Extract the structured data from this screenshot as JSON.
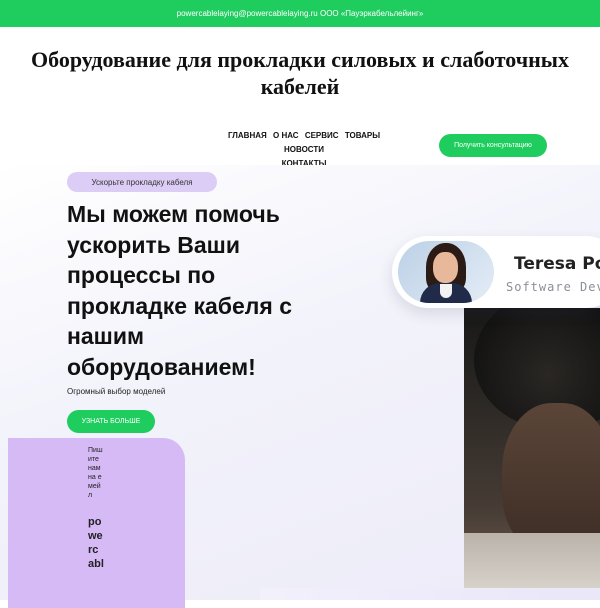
{
  "topbar": {
    "contact_text": "powercablelaying@powercablelaying.ru ООО «Пауэркабельлейинг»"
  },
  "header": {
    "headline": "Оборудование для прокладки силовых и слаботочных кабелей"
  },
  "nav": {
    "items": [
      {
        "label": "ГЛАВНАЯ"
      },
      {
        "label": "О НАС"
      },
      {
        "label": "СЕРВИС"
      },
      {
        "label": "ТОВАРЫ"
      },
      {
        "label": "НОВОСТИ"
      },
      {
        "label": "КОНТАКТЫ"
      }
    ],
    "cta_label": "Получить консультацию"
  },
  "hero": {
    "badge": "Ускорьте прокладку кабеля",
    "title": "Мы можем помочь ускорить Ваши процессы по прокладке кабеля с нашим оборудованием!",
    "subtitle": "Огромный выбор моделей",
    "button_label": "УЗНАТЬ БОЛЬШЕ"
  },
  "email_card": {
    "label": "Пишите нам на емейл",
    "value": "powercabl"
  },
  "profile_card": {
    "name": "Teresa Po",
    "role": "Software Dev"
  },
  "colors": {
    "accent_green": "#1fcd5f",
    "badge_lavender": "#dccdf6",
    "card_purple": "#d6baf5"
  }
}
